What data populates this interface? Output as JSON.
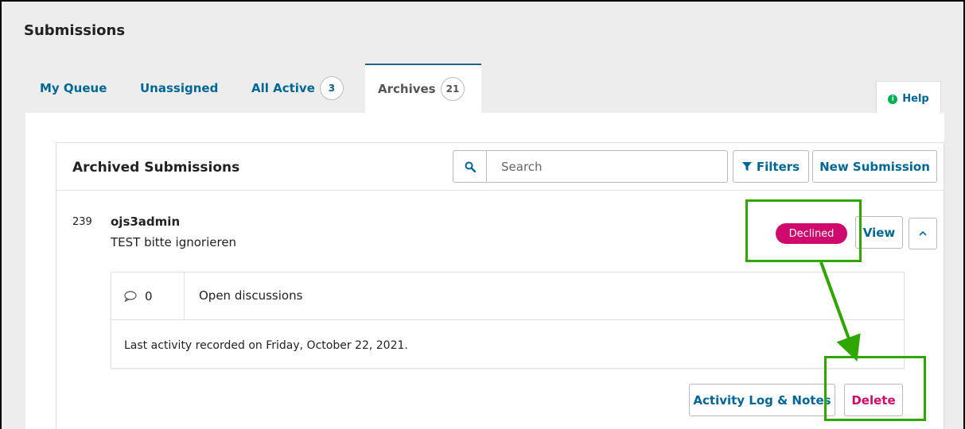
{
  "header": {
    "title": "Submissions"
  },
  "tabs": [
    {
      "label": "My Queue",
      "count": ""
    },
    {
      "label": "Unassigned",
      "count": ""
    },
    {
      "label": "All Active",
      "count": "3"
    },
    {
      "label": "Archives",
      "count": "21"
    }
  ],
  "help": {
    "label": "Help"
  },
  "panel": {
    "title": "Archived Submissions",
    "search_placeholder": "Search",
    "filters_label": "Filters",
    "new_submission_label": "New Submission"
  },
  "submission": {
    "id": "239",
    "author": "ojs3admin",
    "title": "TEST bitte ignorieren",
    "status": "Declined",
    "view_label": "View",
    "discussion_count": "0",
    "discussion_label": "Open discussions",
    "last_activity": "Last activity recorded on Friday, October 22, 2021.",
    "activity_log_label": "Activity Log & Notes",
    "delete_label": "Delete"
  },
  "colors": {
    "link": "#006798",
    "declined": "#d00a6c",
    "annotation": "#2ea800"
  }
}
